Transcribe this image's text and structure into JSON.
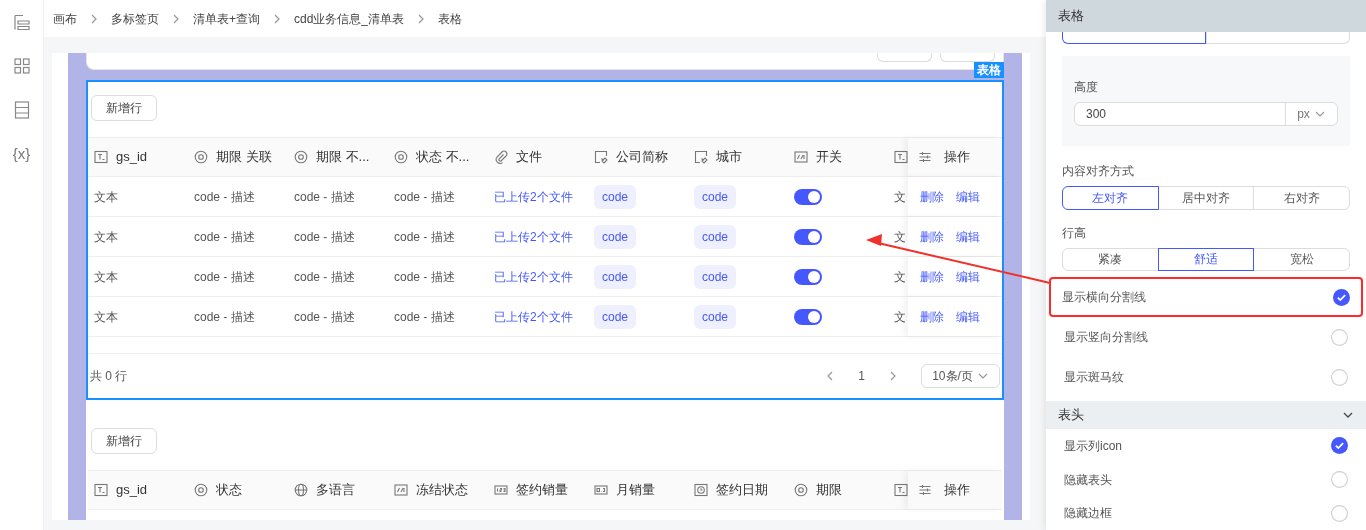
{
  "rail": {
    "variables_label": "{x}"
  },
  "breadcrumb": [
    "画布",
    "多标签页",
    "清单表+查询",
    "cdd业务信息_清单表",
    "表格"
  ],
  "selection_label": "表格",
  "table_1": {
    "add_button": "新增行",
    "columns": [
      {
        "label": "gs_id",
        "kind": "text"
      },
      {
        "label": "期限 关联",
        "kind": "select"
      },
      {
        "label": "期限 不...",
        "kind": "select"
      },
      {
        "label": "状态 不...",
        "kind": "select"
      },
      {
        "label": "文件",
        "kind": "file"
      },
      {
        "label": "公司简称",
        "kind": "link"
      },
      {
        "label": "城市",
        "kind": "link"
      },
      {
        "label": "开关",
        "kind": "switch"
      },
      {
        "kind": "text"
      }
    ],
    "actions_header": "操作",
    "rows": [
      {
        "cells": [
          {
            "text": "文本"
          },
          {
            "text": "code - 描述"
          },
          {
            "text": "code - 描述"
          },
          {
            "text": "code - 描述"
          },
          {
            "text": "已上传2个文件"
          },
          {
            "text": "code"
          },
          {
            "text": "code"
          },
          {
            "on": true
          },
          {
            "text": "文"
          }
        ],
        "actions": [
          "删除",
          "编辑"
        ]
      },
      {
        "cells": [
          {
            "text": "文本"
          },
          {
            "text": "code - 描述"
          },
          {
            "text": "code - 描述"
          },
          {
            "text": "code - 描述"
          },
          {
            "text": "已上传2个文件"
          },
          {
            "text": "code"
          },
          {
            "text": "code"
          },
          {
            "on": true
          },
          {
            "text": "文"
          }
        ],
        "actions": [
          "删除",
          "编辑"
        ]
      },
      {
        "cells": [
          {
            "text": "文本"
          },
          {
            "text": "code - 描述"
          },
          {
            "text": "code - 描述"
          },
          {
            "text": "code - 描述"
          },
          {
            "text": "已上传2个文件"
          },
          {
            "text": "code"
          },
          {
            "text": "code"
          },
          {
            "on": true
          },
          {
            "text": "文"
          }
        ],
        "actions": [
          "删除",
          "编辑"
        ]
      },
      {
        "cells": [
          {
            "text": "文本"
          },
          {
            "text": "code - 描述"
          },
          {
            "text": "code - 描述"
          },
          {
            "text": "code - 描述"
          },
          {
            "text": "已上传2个文件"
          },
          {
            "text": "code"
          },
          {
            "text": "code"
          },
          {
            "on": true
          },
          {
            "text": "文"
          }
        ],
        "actions": [
          "删除",
          "编辑"
        ]
      }
    ],
    "total": "共 0 行",
    "page": "1",
    "page_size": "10条/页"
  },
  "table_2": {
    "add_button": "新增行",
    "columns": [
      {
        "label": "gs_id",
        "kind": "text"
      },
      {
        "label": "状态",
        "kind": "select"
      },
      {
        "label": "多语言",
        "kind": "globe"
      },
      {
        "label": "冻结状态",
        "kind": "switch"
      },
      {
        "label": "签约销量",
        "kind": "number"
      },
      {
        "label": "月销量",
        "kind": "decimal"
      },
      {
        "label": "签约日期",
        "kind": "date"
      },
      {
        "label": "期限",
        "kind": "select"
      },
      {
        "kind": "text"
      }
    ],
    "actions_header": "操作"
  },
  "panel": {
    "title": "表格",
    "height_mode": [
      {
        "selected": true
      },
      {
        "selected": false
      }
    ],
    "height_label": "高度",
    "height_value": "300",
    "height_unit": "px",
    "align": {
      "label": "内容对齐方式",
      "options": [
        {
          "label": "左对齐",
          "selected": true
        },
        {
          "label": "居中对齐",
          "selected": false
        },
        {
          "label": "右对齐",
          "selected": false
        }
      ]
    },
    "row_height": {
      "label": "行高",
      "options": [
        {
          "label": "紧凑",
          "selected": false
        },
        {
          "label": "舒适",
          "selected": true
        },
        {
          "label": "宽松",
          "selected": false
        }
      ]
    },
    "display_options": [
      {
        "label": "显示横向分割线",
        "checked": true,
        "highlighted": true
      },
      {
        "label": "显示竖向分割线",
        "checked": false,
        "highlighted": false
      },
      {
        "label": "显示斑马纹",
        "checked": false,
        "highlighted": false
      }
    ],
    "header_section": {
      "title": "表头",
      "expanded": true,
      "options": [
        {
          "label": "显示列icon",
          "checked": true
        },
        {
          "label": "隐藏表头",
          "checked": false
        },
        {
          "label": "隐藏边框",
          "checked": false
        }
      ]
    }
  }
}
